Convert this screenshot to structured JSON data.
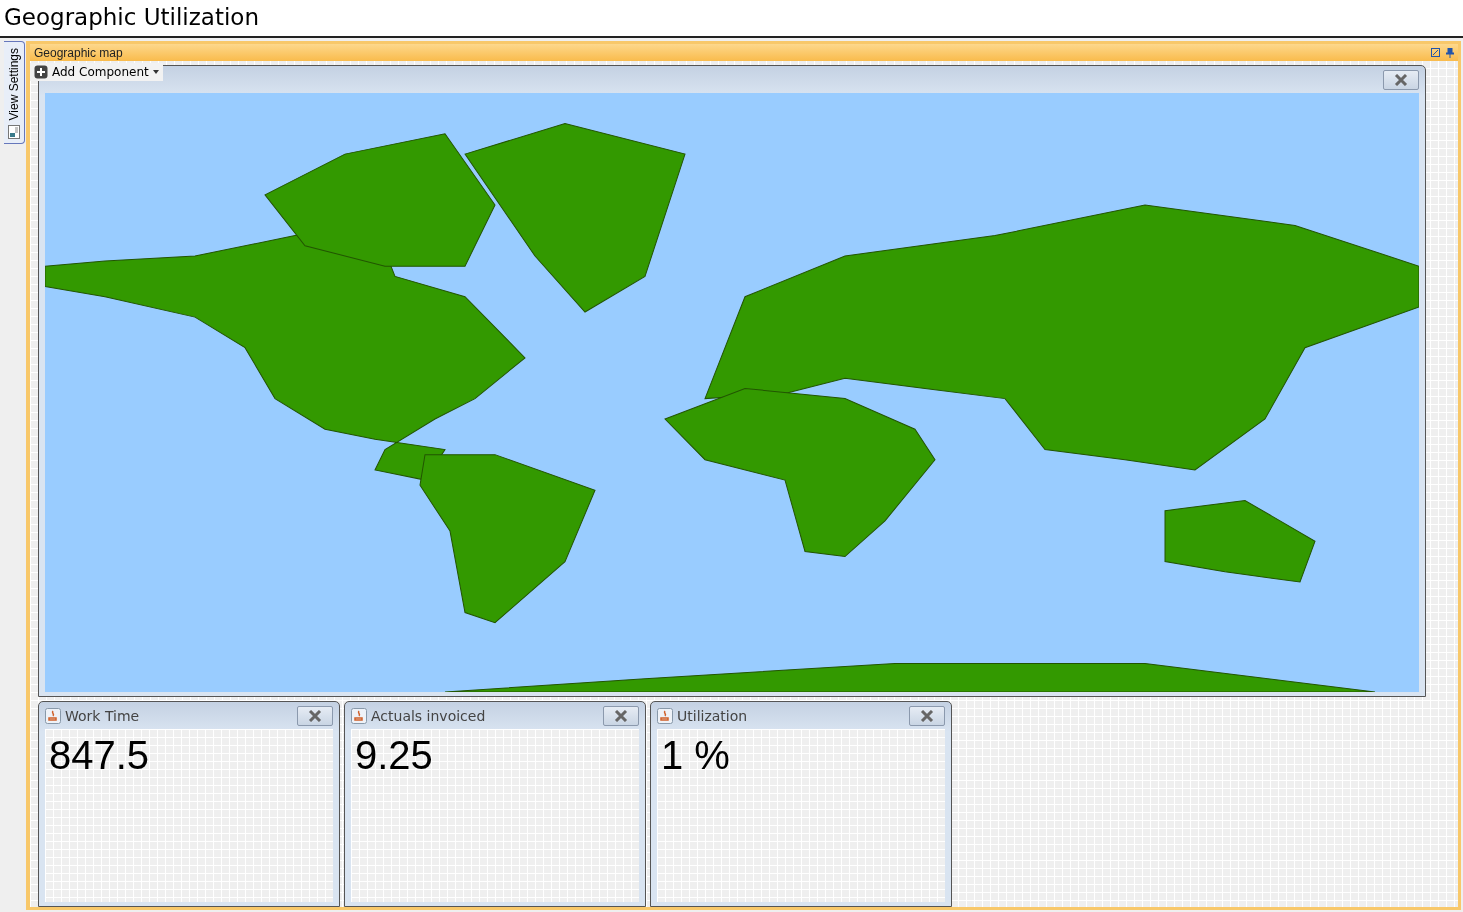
{
  "page_title": "Geographic Utilization",
  "side_tabs": [
    {
      "label": "View Settings",
      "selected": true
    }
  ],
  "panel": {
    "title": "Geographic map",
    "add_button": "Add Component"
  },
  "widgets": [
    {
      "title": "Work Time",
      "value": "847.5"
    },
    {
      "title": "Actuals invoiced",
      "value": "9.25"
    },
    {
      "title": "Utilization",
      "value": "1 %"
    }
  ]
}
